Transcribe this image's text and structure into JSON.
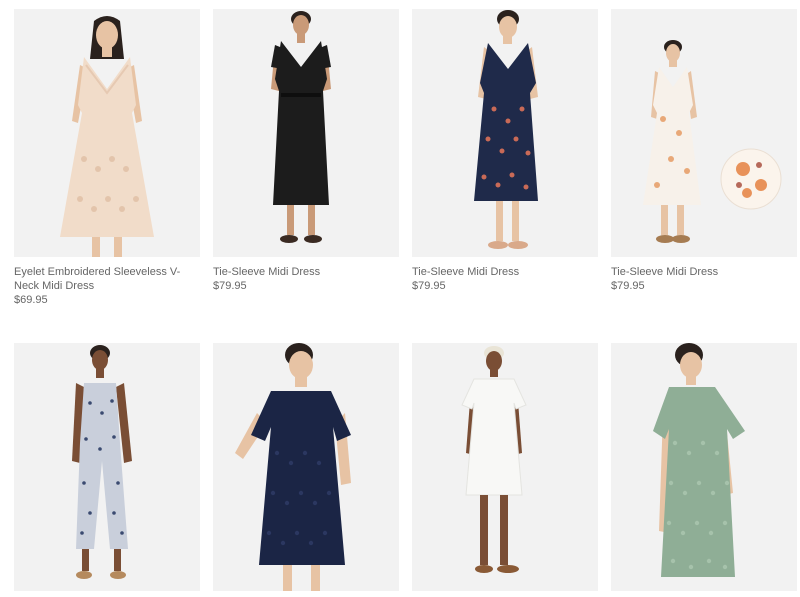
{
  "products": [
    {
      "name": "Eyelet Embroidered Sleeveless V-Neck Midi Dress",
      "price": "$69.95",
      "image": "model-in-blush-eyelet-sleeveless-midi-dress"
    },
    {
      "name": "Tie-Sleeve Midi Dress",
      "price": "$79.95",
      "image": "model-in-black-tie-sleeve-midi-dress"
    },
    {
      "name": "Tie-Sleeve Midi Dress",
      "price": "$79.95",
      "image": "model-in-navy-floral-tie-sleeve-midi-dress"
    },
    {
      "name": "Tie-Sleeve Midi Dress",
      "price": "$79.95",
      "image": "model-in-white-floral-tie-sleeve-midi-dress"
    },
    {
      "name": "",
      "price": "",
      "image": "model-in-printed-sleeveless-jumpsuit"
    },
    {
      "name": "",
      "price": "",
      "image": "model-in-navy-eyelet-shift-dress"
    },
    {
      "name": "",
      "price": "",
      "image": "model-in-white-eyelet-shift-dress"
    },
    {
      "name": "",
      "price": "",
      "image": "model-in-sage-eyelet-shift-dress"
    }
  ],
  "colors": {
    "tile_background": "#f2f2f2",
    "text": "#666666",
    "blush": "#f1dcc9",
    "black": "#1c1c1c",
    "navy_floral": "#1f2a4a",
    "white_floral": "#f7f1ea",
    "jumpsuit_print": "#c9cfdb",
    "navy_eyelet": "#1b2545",
    "white_eyelet": "#f8f8f6",
    "sage_eyelet": "#8fae96",
    "skin_light": "#e7c3a4",
    "skin_medium": "#c99a78",
    "skin_dark": "#7a4e35",
    "hair_dark": "#2a211d",
    "hair_blonde": "#e9e4d6"
  }
}
